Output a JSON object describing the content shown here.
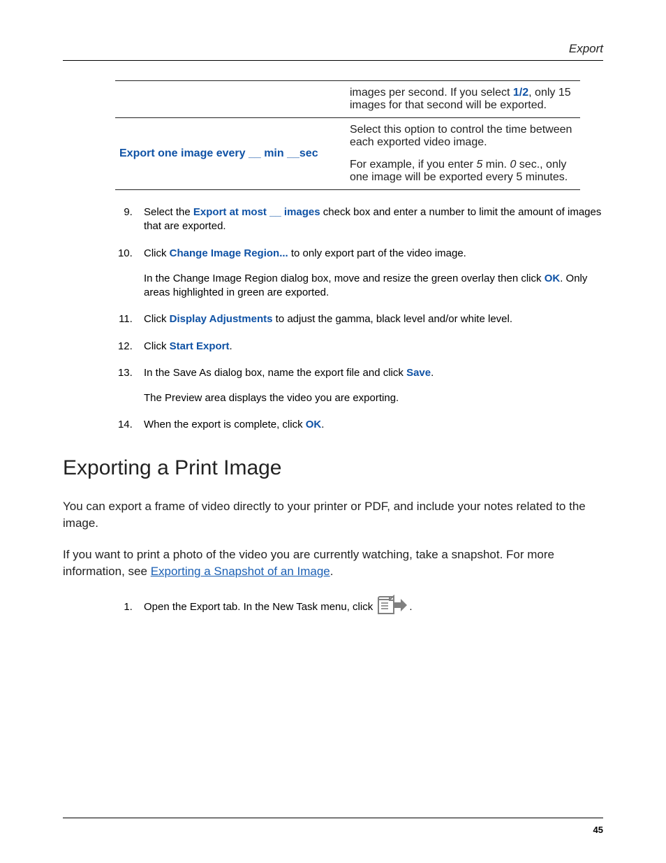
{
  "header": {
    "label": "Export"
  },
  "table": {
    "row1": {
      "left": "",
      "right_pre": "images per second. If you select ",
      "right_bold": "1/2",
      "right_post": ", only 15 images for that second will be exported."
    },
    "row2": {
      "left": "Export one image every __ min __sec",
      "right_p1": "Select this option to control the time between each exported video image.",
      "right_p2_pre": "For example, if you enter ",
      "right_p2_i1": "5",
      "right_p2_mid1": " min. ",
      "right_p2_i2": "0",
      "right_p2_mid2": " sec., only one image will be exported every 5 minutes."
    }
  },
  "steps": {
    "s9_pre": "Select the ",
    "s9_b": "Export at most __ images",
    "s9_post": " check box and enter a number to limit the amount of images that are exported.",
    "s10_pre": "Click ",
    "s10_b": "Change Image Region...",
    "s10_post": " to only export part of the video image.",
    "s10_sub_pre": "In the Change Image Region dialog box, move and resize the green overlay then click ",
    "s10_sub_b": "OK",
    "s10_sub_post": ". Only areas highlighted in green are exported.",
    "s11_pre": "Click ",
    "s11_b": "Display Adjustments",
    "s11_post": " to adjust the gamma, black level and/or white level.",
    "s12_pre": "Click ",
    "s12_b": "Start Export",
    "s12_post": ".",
    "s13_pre": "In the Save As dialog box, name the export file and click ",
    "s13_b": "Save",
    "s13_post": ".",
    "s13_sub": "The Preview area displays the video you are exporting.",
    "s14_pre": "When the export is complete, click ",
    "s14_b": "OK",
    "s14_post": "."
  },
  "section": {
    "title": "Exporting a Print Image"
  },
  "para1": "You can export a frame of video directly to your printer or PDF, and include your notes related to the image.",
  "para2_pre": "If you want to print a photo of the video you are currently watching, take a snapshot. For more information, see ",
  "para2_link": "Exporting a Snapshot of an Image",
  "para2_post": ".",
  "steps2": {
    "s1_pre": "Open the Export tab. In the New Task menu, click ",
    "s1_post": "."
  },
  "footer": {
    "page": "45"
  }
}
